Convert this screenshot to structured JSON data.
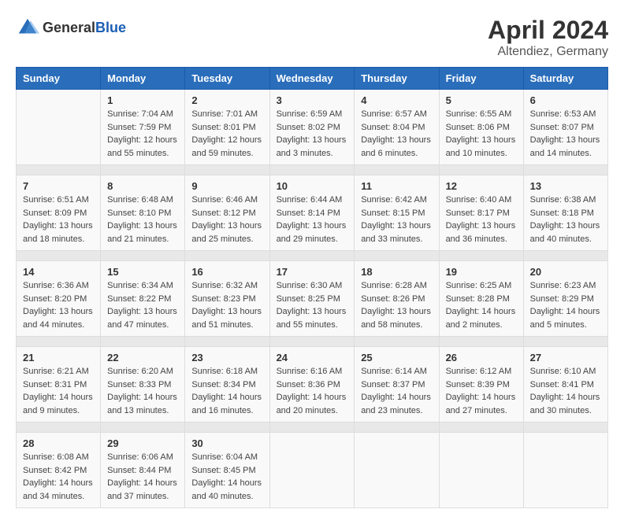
{
  "logo": {
    "general": "General",
    "blue": "Blue"
  },
  "title": "April 2024",
  "subtitle": "Altendiez, Germany",
  "days_of_week": [
    "Sunday",
    "Monday",
    "Tuesday",
    "Wednesday",
    "Thursday",
    "Friday",
    "Saturday"
  ],
  "weeks": [
    [
      {
        "day": "",
        "info": ""
      },
      {
        "day": "1",
        "info": "Sunrise: 7:04 AM\nSunset: 7:59 PM\nDaylight: 12 hours\nand 55 minutes."
      },
      {
        "day": "2",
        "info": "Sunrise: 7:01 AM\nSunset: 8:01 PM\nDaylight: 12 hours\nand 59 minutes."
      },
      {
        "day": "3",
        "info": "Sunrise: 6:59 AM\nSunset: 8:02 PM\nDaylight: 13 hours\nand 3 minutes."
      },
      {
        "day": "4",
        "info": "Sunrise: 6:57 AM\nSunset: 8:04 PM\nDaylight: 13 hours\nand 6 minutes."
      },
      {
        "day": "5",
        "info": "Sunrise: 6:55 AM\nSunset: 8:06 PM\nDaylight: 13 hours\nand 10 minutes."
      },
      {
        "day": "6",
        "info": "Sunrise: 6:53 AM\nSunset: 8:07 PM\nDaylight: 13 hours\nand 14 minutes."
      }
    ],
    [
      {
        "day": "7",
        "info": "Sunrise: 6:51 AM\nSunset: 8:09 PM\nDaylight: 13 hours\nand 18 minutes."
      },
      {
        "day": "8",
        "info": "Sunrise: 6:48 AM\nSunset: 8:10 PM\nDaylight: 13 hours\nand 21 minutes."
      },
      {
        "day": "9",
        "info": "Sunrise: 6:46 AM\nSunset: 8:12 PM\nDaylight: 13 hours\nand 25 minutes."
      },
      {
        "day": "10",
        "info": "Sunrise: 6:44 AM\nSunset: 8:14 PM\nDaylight: 13 hours\nand 29 minutes."
      },
      {
        "day": "11",
        "info": "Sunrise: 6:42 AM\nSunset: 8:15 PM\nDaylight: 13 hours\nand 33 minutes."
      },
      {
        "day": "12",
        "info": "Sunrise: 6:40 AM\nSunset: 8:17 PM\nDaylight: 13 hours\nand 36 minutes."
      },
      {
        "day": "13",
        "info": "Sunrise: 6:38 AM\nSunset: 8:18 PM\nDaylight: 13 hours\nand 40 minutes."
      }
    ],
    [
      {
        "day": "14",
        "info": "Sunrise: 6:36 AM\nSunset: 8:20 PM\nDaylight: 13 hours\nand 44 minutes."
      },
      {
        "day": "15",
        "info": "Sunrise: 6:34 AM\nSunset: 8:22 PM\nDaylight: 13 hours\nand 47 minutes."
      },
      {
        "day": "16",
        "info": "Sunrise: 6:32 AM\nSunset: 8:23 PM\nDaylight: 13 hours\nand 51 minutes."
      },
      {
        "day": "17",
        "info": "Sunrise: 6:30 AM\nSunset: 8:25 PM\nDaylight: 13 hours\nand 55 minutes."
      },
      {
        "day": "18",
        "info": "Sunrise: 6:28 AM\nSunset: 8:26 PM\nDaylight: 13 hours\nand 58 minutes."
      },
      {
        "day": "19",
        "info": "Sunrise: 6:25 AM\nSunset: 8:28 PM\nDaylight: 14 hours\nand 2 minutes."
      },
      {
        "day": "20",
        "info": "Sunrise: 6:23 AM\nSunset: 8:29 PM\nDaylight: 14 hours\nand 5 minutes."
      }
    ],
    [
      {
        "day": "21",
        "info": "Sunrise: 6:21 AM\nSunset: 8:31 PM\nDaylight: 14 hours\nand 9 minutes."
      },
      {
        "day": "22",
        "info": "Sunrise: 6:20 AM\nSunset: 8:33 PM\nDaylight: 14 hours\nand 13 minutes."
      },
      {
        "day": "23",
        "info": "Sunrise: 6:18 AM\nSunset: 8:34 PM\nDaylight: 14 hours\nand 16 minutes."
      },
      {
        "day": "24",
        "info": "Sunrise: 6:16 AM\nSunset: 8:36 PM\nDaylight: 14 hours\nand 20 minutes."
      },
      {
        "day": "25",
        "info": "Sunrise: 6:14 AM\nSunset: 8:37 PM\nDaylight: 14 hours\nand 23 minutes."
      },
      {
        "day": "26",
        "info": "Sunrise: 6:12 AM\nSunset: 8:39 PM\nDaylight: 14 hours\nand 27 minutes."
      },
      {
        "day": "27",
        "info": "Sunrise: 6:10 AM\nSunset: 8:41 PM\nDaylight: 14 hours\nand 30 minutes."
      }
    ],
    [
      {
        "day": "28",
        "info": "Sunrise: 6:08 AM\nSunset: 8:42 PM\nDaylight: 14 hours\nand 34 minutes."
      },
      {
        "day": "29",
        "info": "Sunrise: 6:06 AM\nSunset: 8:44 PM\nDaylight: 14 hours\nand 37 minutes."
      },
      {
        "day": "30",
        "info": "Sunrise: 6:04 AM\nSunset: 8:45 PM\nDaylight: 14 hours\nand 40 minutes."
      },
      {
        "day": "",
        "info": ""
      },
      {
        "day": "",
        "info": ""
      },
      {
        "day": "",
        "info": ""
      },
      {
        "day": "",
        "info": ""
      }
    ]
  ]
}
